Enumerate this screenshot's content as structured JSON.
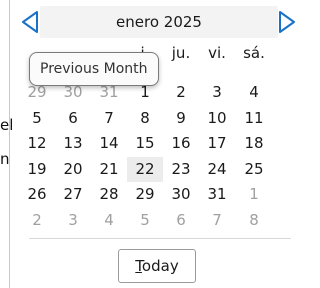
{
  "calendar": {
    "month_label": "enero 2025",
    "weekdays": [
      "",
      "",
      "",
      "ju.",
      "ju.",
      "vi.",
      "sá."
    ],
    "weekday_visible": [
      "i.",
      "ju.",
      "vi.",
      "sá."
    ],
    "weeks": [
      [
        {
          "d": "29",
          "muted": true
        },
        {
          "d": "30",
          "muted": true
        },
        {
          "d": "31",
          "muted": true
        },
        {
          "d": "1",
          "muted": false
        },
        {
          "d": "2",
          "muted": false
        },
        {
          "d": "3",
          "muted": false
        },
        {
          "d": "4",
          "muted": false
        }
      ],
      [
        {
          "d": "5",
          "muted": false
        },
        {
          "d": "6",
          "muted": false
        },
        {
          "d": "7",
          "muted": false
        },
        {
          "d": "8",
          "muted": false
        },
        {
          "d": "9",
          "muted": false
        },
        {
          "d": "10",
          "muted": false
        },
        {
          "d": "11",
          "muted": false
        }
      ],
      [
        {
          "d": "12",
          "muted": false
        },
        {
          "d": "13",
          "muted": false
        },
        {
          "d": "14",
          "muted": false
        },
        {
          "d": "15",
          "muted": false
        },
        {
          "d": "16",
          "muted": false
        },
        {
          "d": "17",
          "muted": false
        },
        {
          "d": "18",
          "muted": false
        }
      ],
      [
        {
          "d": "19",
          "muted": false
        },
        {
          "d": "20",
          "muted": false
        },
        {
          "d": "21",
          "muted": false
        },
        {
          "d": "22",
          "muted": false,
          "today": true
        },
        {
          "d": "23",
          "muted": false
        },
        {
          "d": "24",
          "muted": false
        },
        {
          "d": "25",
          "muted": false
        }
      ],
      [
        {
          "d": "26",
          "muted": false
        },
        {
          "d": "27",
          "muted": false
        },
        {
          "d": "28",
          "muted": false
        },
        {
          "d": "29",
          "muted": false
        },
        {
          "d": "30",
          "muted": false
        },
        {
          "d": "31",
          "muted": false
        },
        {
          "d": "1",
          "muted": true
        }
      ],
      [
        {
          "d": "2",
          "muted": true
        },
        {
          "d": "3",
          "muted": true
        },
        {
          "d": "4",
          "muted": true
        },
        {
          "d": "5",
          "muted": true
        },
        {
          "d": "6",
          "muted": true
        },
        {
          "d": "7",
          "muted": true
        },
        {
          "d": "8",
          "muted": true
        }
      ]
    ],
    "today_button": {
      "underlined": "T",
      "rest": "oday"
    },
    "tooltip": "Previous Month",
    "prev_icon": "triangle-left-icon",
    "next_icon": "triangle-right-icon"
  },
  "background_fragments": [
    "el",
    "n"
  ],
  "colors": {
    "accent": "#1a72c8",
    "muted_day": "#a0a0a0",
    "header_band": "#f3f3f3",
    "today_highlight": "#ececec"
  }
}
